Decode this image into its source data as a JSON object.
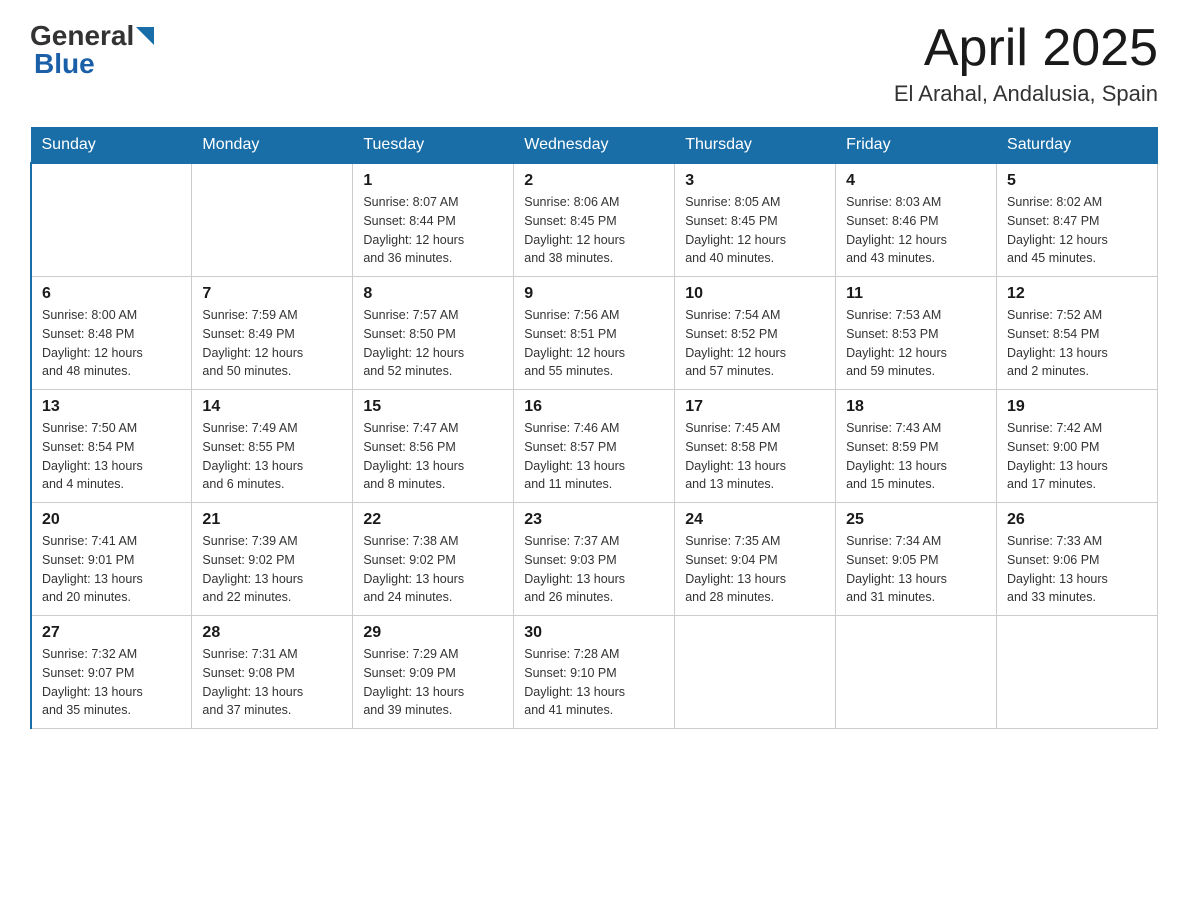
{
  "header": {
    "logo_general": "General",
    "logo_blue": "Blue",
    "month": "April 2025",
    "location": "El Arahal, Andalusia, Spain"
  },
  "weekdays": [
    "Sunday",
    "Monday",
    "Tuesday",
    "Wednesday",
    "Thursday",
    "Friday",
    "Saturday"
  ],
  "weeks": [
    [
      {
        "day": "",
        "info": ""
      },
      {
        "day": "",
        "info": ""
      },
      {
        "day": "1",
        "info": "Sunrise: 8:07 AM\nSunset: 8:44 PM\nDaylight: 12 hours\nand 36 minutes."
      },
      {
        "day": "2",
        "info": "Sunrise: 8:06 AM\nSunset: 8:45 PM\nDaylight: 12 hours\nand 38 minutes."
      },
      {
        "day": "3",
        "info": "Sunrise: 8:05 AM\nSunset: 8:45 PM\nDaylight: 12 hours\nand 40 minutes."
      },
      {
        "day": "4",
        "info": "Sunrise: 8:03 AM\nSunset: 8:46 PM\nDaylight: 12 hours\nand 43 minutes."
      },
      {
        "day": "5",
        "info": "Sunrise: 8:02 AM\nSunset: 8:47 PM\nDaylight: 12 hours\nand 45 minutes."
      }
    ],
    [
      {
        "day": "6",
        "info": "Sunrise: 8:00 AM\nSunset: 8:48 PM\nDaylight: 12 hours\nand 48 minutes."
      },
      {
        "day": "7",
        "info": "Sunrise: 7:59 AM\nSunset: 8:49 PM\nDaylight: 12 hours\nand 50 minutes."
      },
      {
        "day": "8",
        "info": "Sunrise: 7:57 AM\nSunset: 8:50 PM\nDaylight: 12 hours\nand 52 minutes."
      },
      {
        "day": "9",
        "info": "Sunrise: 7:56 AM\nSunset: 8:51 PM\nDaylight: 12 hours\nand 55 minutes."
      },
      {
        "day": "10",
        "info": "Sunrise: 7:54 AM\nSunset: 8:52 PM\nDaylight: 12 hours\nand 57 minutes."
      },
      {
        "day": "11",
        "info": "Sunrise: 7:53 AM\nSunset: 8:53 PM\nDaylight: 12 hours\nand 59 minutes."
      },
      {
        "day": "12",
        "info": "Sunrise: 7:52 AM\nSunset: 8:54 PM\nDaylight: 13 hours\nand 2 minutes."
      }
    ],
    [
      {
        "day": "13",
        "info": "Sunrise: 7:50 AM\nSunset: 8:54 PM\nDaylight: 13 hours\nand 4 minutes."
      },
      {
        "day": "14",
        "info": "Sunrise: 7:49 AM\nSunset: 8:55 PM\nDaylight: 13 hours\nand 6 minutes."
      },
      {
        "day": "15",
        "info": "Sunrise: 7:47 AM\nSunset: 8:56 PM\nDaylight: 13 hours\nand 8 minutes."
      },
      {
        "day": "16",
        "info": "Sunrise: 7:46 AM\nSunset: 8:57 PM\nDaylight: 13 hours\nand 11 minutes."
      },
      {
        "day": "17",
        "info": "Sunrise: 7:45 AM\nSunset: 8:58 PM\nDaylight: 13 hours\nand 13 minutes."
      },
      {
        "day": "18",
        "info": "Sunrise: 7:43 AM\nSunset: 8:59 PM\nDaylight: 13 hours\nand 15 minutes."
      },
      {
        "day": "19",
        "info": "Sunrise: 7:42 AM\nSunset: 9:00 PM\nDaylight: 13 hours\nand 17 minutes."
      }
    ],
    [
      {
        "day": "20",
        "info": "Sunrise: 7:41 AM\nSunset: 9:01 PM\nDaylight: 13 hours\nand 20 minutes."
      },
      {
        "day": "21",
        "info": "Sunrise: 7:39 AM\nSunset: 9:02 PM\nDaylight: 13 hours\nand 22 minutes."
      },
      {
        "day": "22",
        "info": "Sunrise: 7:38 AM\nSunset: 9:02 PM\nDaylight: 13 hours\nand 24 minutes."
      },
      {
        "day": "23",
        "info": "Sunrise: 7:37 AM\nSunset: 9:03 PM\nDaylight: 13 hours\nand 26 minutes."
      },
      {
        "day": "24",
        "info": "Sunrise: 7:35 AM\nSunset: 9:04 PM\nDaylight: 13 hours\nand 28 minutes."
      },
      {
        "day": "25",
        "info": "Sunrise: 7:34 AM\nSunset: 9:05 PM\nDaylight: 13 hours\nand 31 minutes."
      },
      {
        "day": "26",
        "info": "Sunrise: 7:33 AM\nSunset: 9:06 PM\nDaylight: 13 hours\nand 33 minutes."
      }
    ],
    [
      {
        "day": "27",
        "info": "Sunrise: 7:32 AM\nSunset: 9:07 PM\nDaylight: 13 hours\nand 35 minutes."
      },
      {
        "day": "28",
        "info": "Sunrise: 7:31 AM\nSunset: 9:08 PM\nDaylight: 13 hours\nand 37 minutes."
      },
      {
        "day": "29",
        "info": "Sunrise: 7:29 AM\nSunset: 9:09 PM\nDaylight: 13 hours\nand 39 minutes."
      },
      {
        "day": "30",
        "info": "Sunrise: 7:28 AM\nSunset: 9:10 PM\nDaylight: 13 hours\nand 41 minutes."
      },
      {
        "day": "",
        "info": ""
      },
      {
        "day": "",
        "info": ""
      },
      {
        "day": "",
        "info": ""
      }
    ]
  ]
}
